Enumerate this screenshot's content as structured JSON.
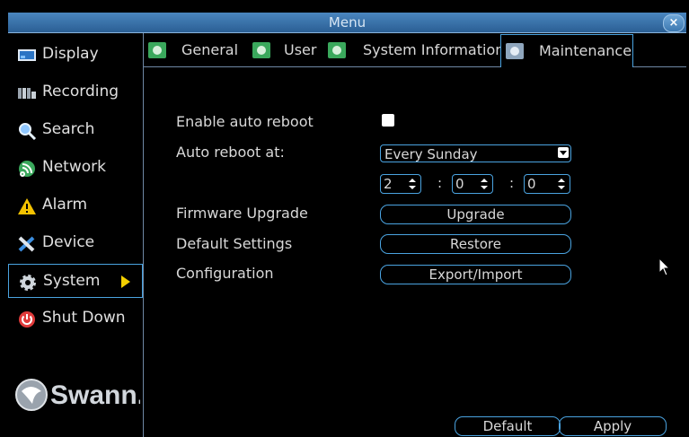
{
  "window": {
    "title": "Menu",
    "close": "×"
  },
  "sidebar": {
    "items": [
      {
        "label": "Display",
        "icon": "display-icon"
      },
      {
        "label": "Recording",
        "icon": "recording-icon"
      },
      {
        "label": "Search",
        "icon": "search-icon"
      },
      {
        "label": "Network",
        "icon": "network-icon"
      },
      {
        "label": "Alarm",
        "icon": "alarm-icon"
      },
      {
        "label": "Device",
        "icon": "device-icon"
      },
      {
        "label": "System",
        "icon": "gear-icon",
        "active": true
      },
      {
        "label": "Shut Down",
        "icon": "power-icon"
      }
    ],
    "logo": "Swann."
  },
  "tabs": [
    {
      "label": "General"
    },
    {
      "label": "User"
    },
    {
      "label": "System Information"
    },
    {
      "label": "Maintenance",
      "active": true
    }
  ],
  "maintenance": {
    "enable_auto_reboot_label": "Enable auto reboot",
    "auto_reboot_at_label": "Auto reboot at:",
    "schedule_value": "Every Sunday",
    "hour": "2",
    "minute": "0",
    "second": "0",
    "time_sep": ":",
    "firmware_label": "Firmware Upgrade",
    "upgrade_button": "Upgrade",
    "default_settings_label": "Default Settings",
    "restore_button": "Restore",
    "configuration_label": "Configuration",
    "export_import_button": "Export/Import"
  },
  "footer": {
    "default_button": "Default",
    "apply_button": "Apply"
  },
  "colors": {
    "accent": "#4aa3e0",
    "titlebar": "#3a73a8",
    "arrow": "#f4d000"
  }
}
